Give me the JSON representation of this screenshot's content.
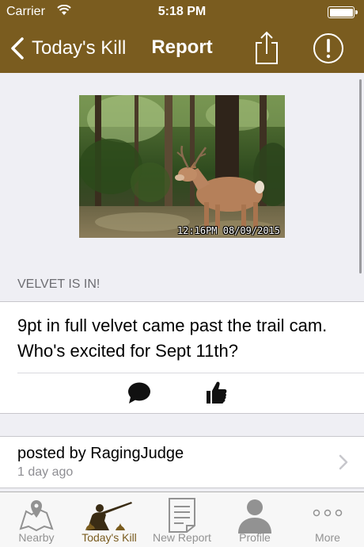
{
  "status_bar": {
    "carrier": "Carrier",
    "time": "5:18 PM"
  },
  "nav": {
    "back_label": "Today's Kill",
    "title": "Report",
    "share_icon": "share-icon",
    "alert_icon": "alert-circle-icon"
  },
  "photo": {
    "timestamp": "12:16PM 08/09/2015"
  },
  "post": {
    "section_title": "VELVET IS IN!",
    "body": "9pt in full velvet came past the trail cam. Who's excited for Sept 11th?",
    "comment_icon": "comment-bubble-icon",
    "like_icon": "thumbs-up-icon"
  },
  "author": {
    "posted_by": "posted by RagingJudge",
    "time_ago": "1 day ago"
  },
  "tabs": [
    {
      "label": "Nearby",
      "icon": "map-pin-icon",
      "active": false
    },
    {
      "label": "Today's Kill",
      "icon": "hunter-icon",
      "active": true
    },
    {
      "label": "New Report",
      "icon": "document-icon",
      "active": false
    },
    {
      "label": "Profile",
      "icon": "person-icon",
      "active": false
    },
    {
      "label": "More",
      "icon": "more-dots-icon",
      "active": false
    }
  ],
  "colors": {
    "brand": "#7a5c1f",
    "tab_inactive": "#929292",
    "background": "#efeff4"
  }
}
